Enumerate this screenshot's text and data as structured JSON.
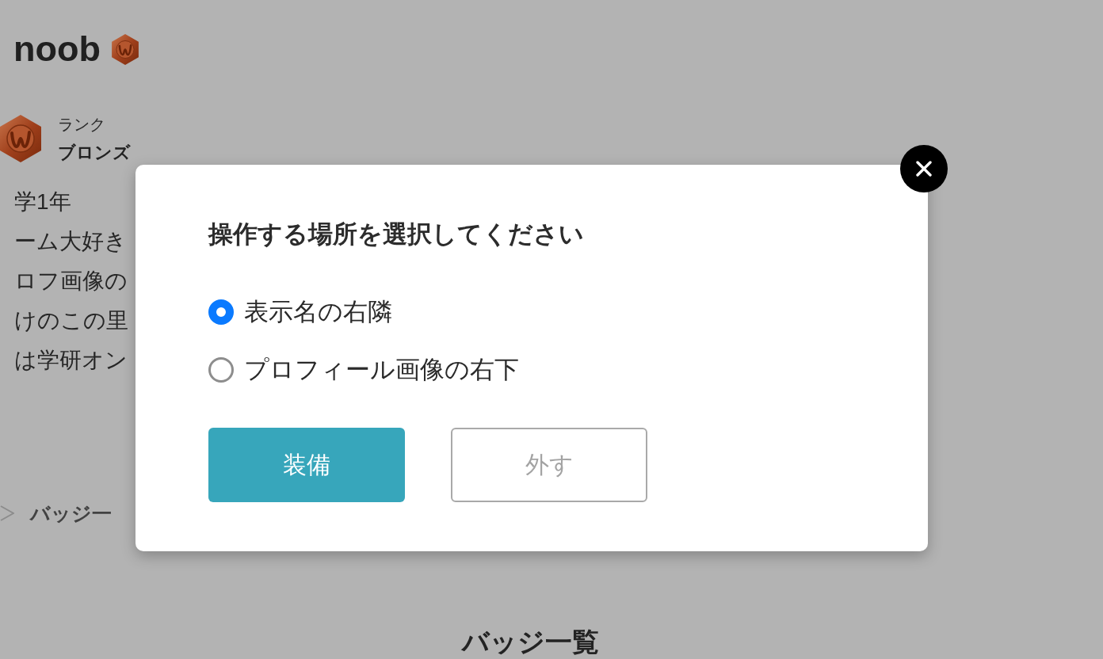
{
  "profile": {
    "display_name": "noob",
    "rank": {
      "label": "ランク",
      "value": "ブロンズ"
    },
    "bio_lines": [
      "学1年",
      "ーム大好き",
      "ロフ画像の",
      "けのこの里",
      "は学研オン"
    ],
    "badge_link": {
      "label": "バッジ一"
    }
  },
  "badge_section": {
    "title": "バッジ一覧"
  },
  "modal": {
    "title": "操作する場所を選択してください",
    "options": [
      {
        "label": "表示名の右隣",
        "selected": true
      },
      {
        "label": "プロフィール画像の右下",
        "selected": false
      }
    ],
    "buttons": [
      {
        "label": "装備",
        "kind": "primary"
      },
      {
        "label": "外す",
        "kind": "outline"
      }
    ]
  }
}
